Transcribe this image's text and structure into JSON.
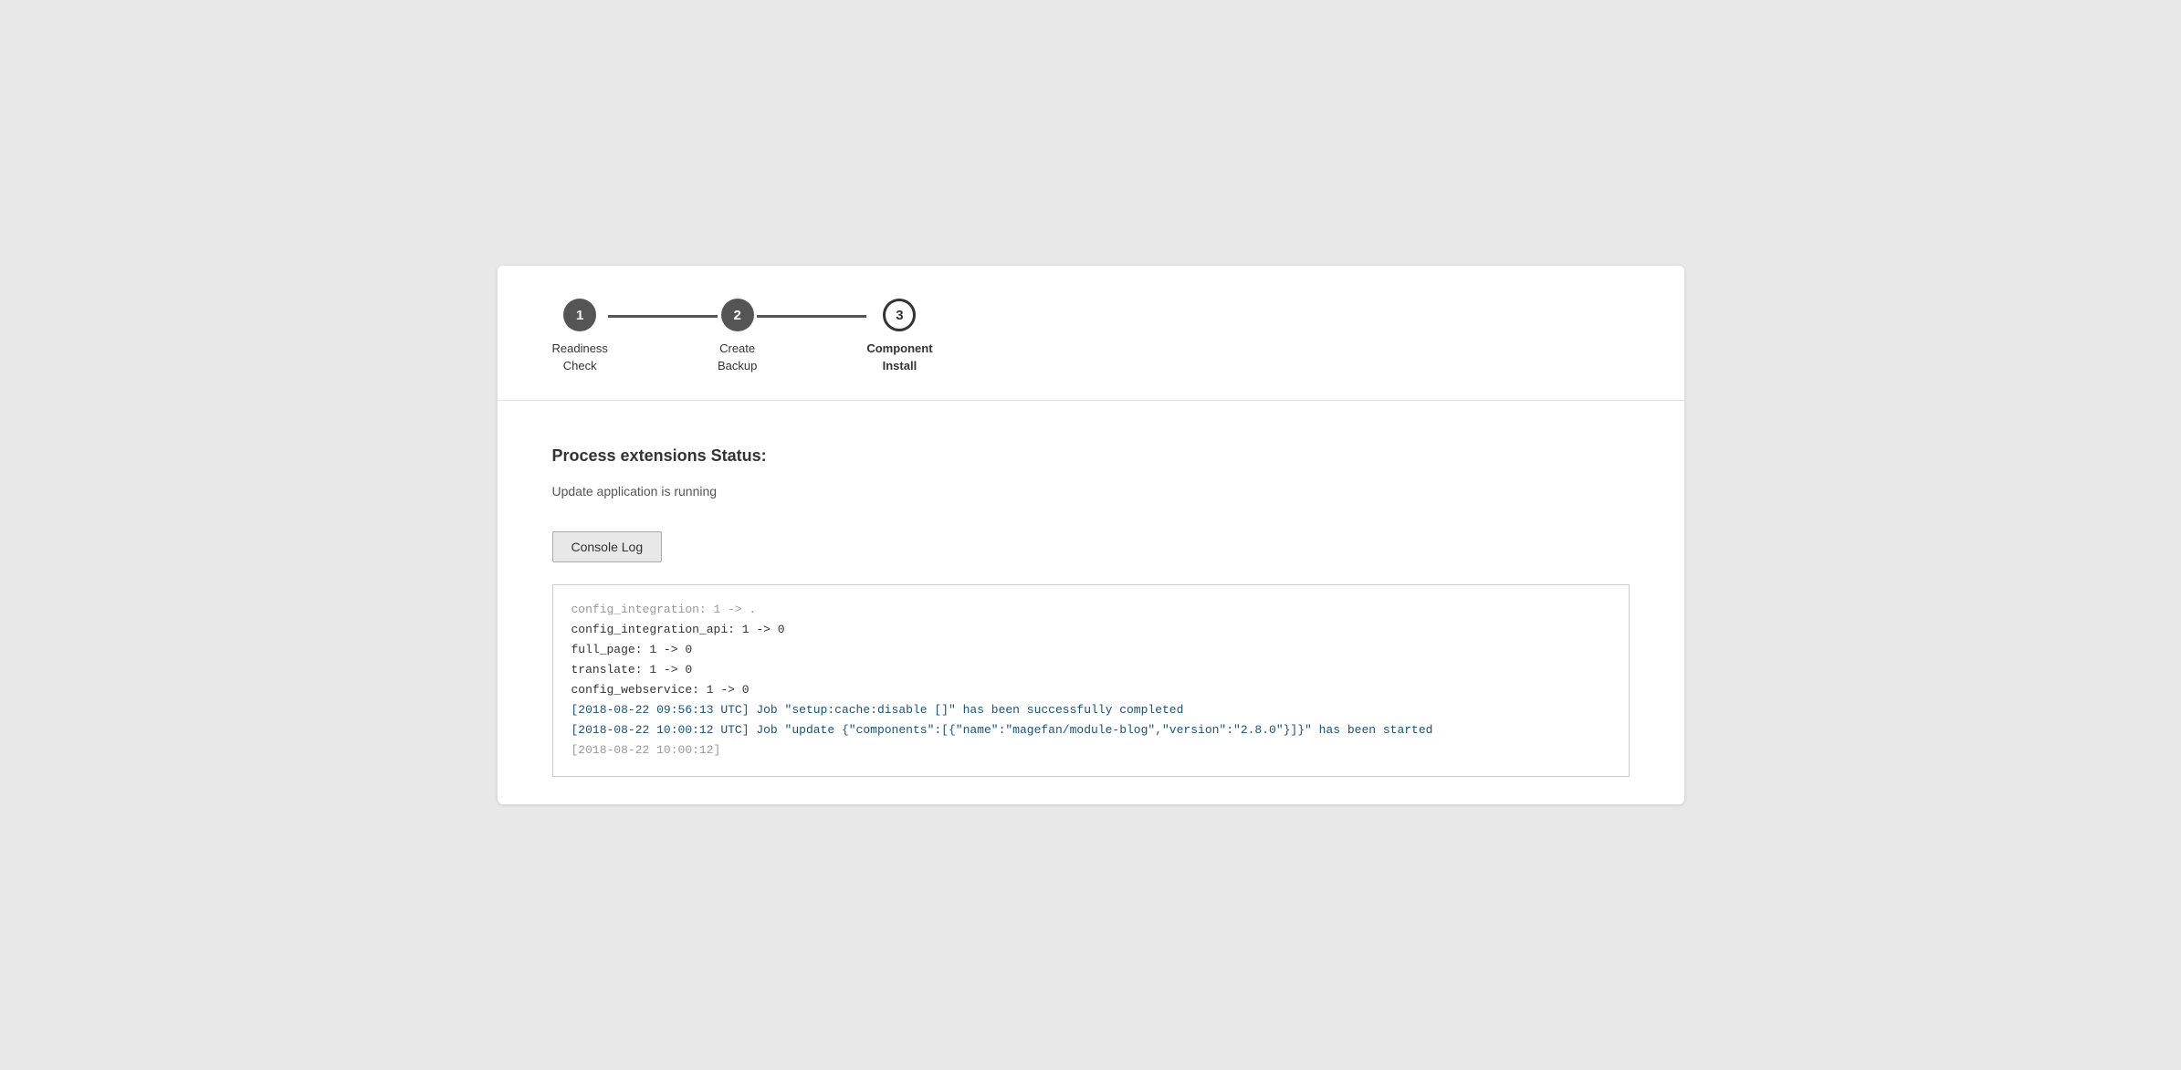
{
  "stepper": {
    "steps": [
      {
        "number": "1",
        "label": "Readiness\nCheck",
        "state": "completed",
        "bold": false
      },
      {
        "number": "2",
        "label": "Create\nBackup",
        "state": "completed",
        "bold": false
      },
      {
        "number": "3",
        "label": "Component\nInstall",
        "state": "active",
        "bold": true
      }
    ]
  },
  "content": {
    "process_title": "Process extensions Status:",
    "status_text": "Update application is running",
    "console_log_button": "Console Log",
    "console_lines": [
      {
        "text": "config_integration: 1 -> .",
        "style": "dimmed"
      },
      {
        "text": "config_integration_api: 1 -> 0",
        "style": ""
      },
      {
        "text": "full_page: 1 -> 0",
        "style": ""
      },
      {
        "text": "translate: 1 -> 0",
        "style": ""
      },
      {
        "text": "config_webservice: 1 -> 0",
        "style": ""
      },
      {
        "text": "",
        "style": ""
      },
      {
        "text": "[2018-08-22 09:56:13 UTC] Job \"setup:cache:disable []\" has been successfully completed",
        "style": "blue"
      },
      {
        "text": "[2018-08-22 10:00:12 UTC] Job \"update {\"components\":[{\"name\":\"magefan/module-blog\",\"version\":\"2.8.0\"}]}\" has been started",
        "style": "blue"
      },
      {
        "text": "[2018-08-22 10:00:12]",
        "style": "dimmed"
      }
    ]
  }
}
